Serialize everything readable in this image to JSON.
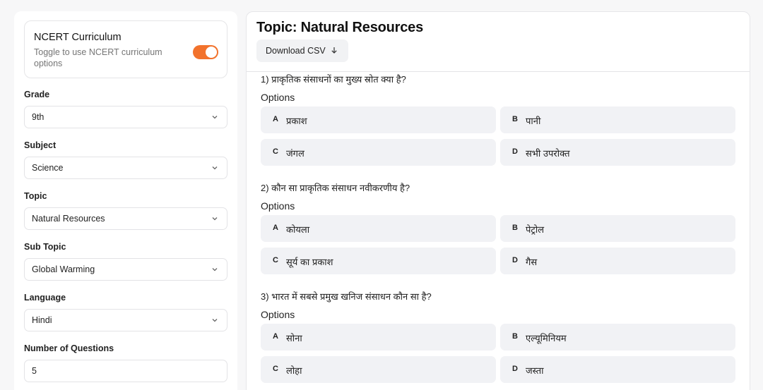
{
  "sidebar": {
    "ncert": {
      "title": "NCERT Curriculum",
      "description": "Toggle to use NCERT curriculum options",
      "enabled": true,
      "accent_color": "#f2722c"
    },
    "fields": [
      {
        "label": "Grade",
        "value": "9th"
      },
      {
        "label": "Subject",
        "value": "Science"
      },
      {
        "label": "Topic",
        "value": "Natural Resources"
      },
      {
        "label": "Sub Topic",
        "value": "Global Warming"
      },
      {
        "label": "Language",
        "value": "Hindi"
      }
    ],
    "num_questions": {
      "label": "Number of Questions",
      "value": "5"
    }
  },
  "main": {
    "title": "Topic: Natural Resources",
    "download_label": "Download CSV",
    "options_label": "Options",
    "questions": [
      {
        "text": "1) प्राकृतिक संसाधनों का मुख्य स्रोत क्या है?",
        "options": [
          {
            "letter": "A",
            "text": "प्रकाश"
          },
          {
            "letter": "B",
            "text": "पानी"
          },
          {
            "letter": "C",
            "text": "जंगल"
          },
          {
            "letter": "D",
            "text": "सभी उपरोक्त"
          }
        ]
      },
      {
        "text": "2) कौन सा प्राकृतिक संसाधन नवीकरणीय है?",
        "options": [
          {
            "letter": "A",
            "text": "कोयला"
          },
          {
            "letter": "B",
            "text": "पेट्रोल"
          },
          {
            "letter": "C",
            "text": "सूर्य का प्रकाश"
          },
          {
            "letter": "D",
            "text": "गैस"
          }
        ]
      },
      {
        "text": "3) भारत में सबसे प्रमुख खनिज संसाधन कौन सा है?",
        "options": [
          {
            "letter": "A",
            "text": "सोना"
          },
          {
            "letter": "B",
            "text": "एल्यूमिनियम"
          },
          {
            "letter": "C",
            "text": "लोहा"
          },
          {
            "letter": "D",
            "text": "जस्ता"
          }
        ]
      }
    ]
  }
}
